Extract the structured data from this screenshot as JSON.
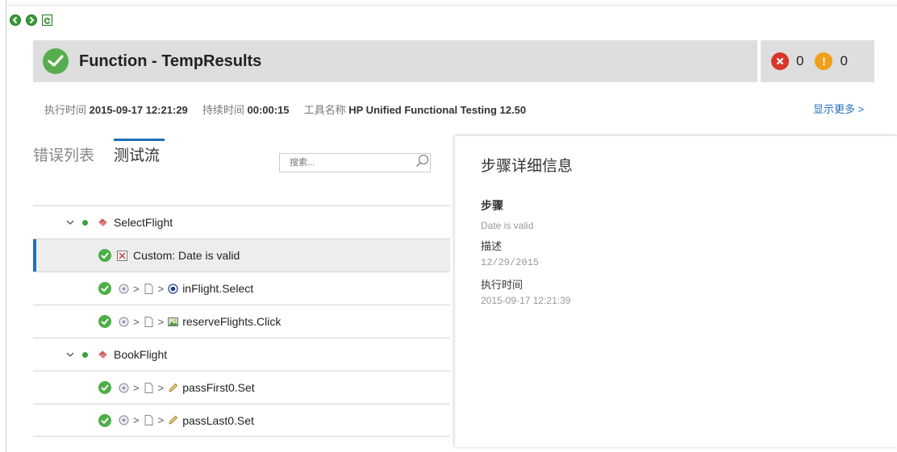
{
  "report": {
    "title": "Function - TempResults",
    "error_count": "0",
    "warning_count": "0"
  },
  "meta": {
    "exec_time_label": "执行时间",
    "exec_time_value": "2015-09-17 12:21:29",
    "duration_label": "持续时间",
    "duration_value": "00:00:15",
    "tool_label": "工具名称",
    "tool_value": "HP Unified Functional Testing 12.50",
    "more_link": "显示更多 >"
  },
  "tabs": [
    {
      "label": "错误列表",
      "active": false
    },
    {
      "label": "测试流",
      "active": true
    }
  ],
  "search": {
    "placeholder": "搜索..."
  },
  "tree": {
    "rows": [
      {
        "type": "group",
        "label": "SelectFlight"
      },
      {
        "type": "check",
        "label": "Custom: Date is valid",
        "selected": true
      },
      {
        "type": "step",
        "object": "inFlight",
        "method": ".Select",
        "icon": "radio-icon"
      },
      {
        "type": "step",
        "object": "reserveFlights",
        "method": ".Click",
        "icon": "image-icon"
      },
      {
        "type": "group",
        "label": "BookFlight"
      },
      {
        "type": "step",
        "object": "passFirst0",
        "method": ".Set",
        "icon": "edit-icon"
      },
      {
        "type": "step",
        "object": "passLast0",
        "method": ".Set",
        "icon": "edit-icon"
      }
    ]
  },
  "details": {
    "title": "步骤详细信息",
    "step_label": "步骤",
    "step_value": "Date is valid",
    "desc_label": "描述",
    "desc_value": "12/29/2015",
    "time_label": "执行时间",
    "time_value": "2015-09-17 12:21:39"
  }
}
